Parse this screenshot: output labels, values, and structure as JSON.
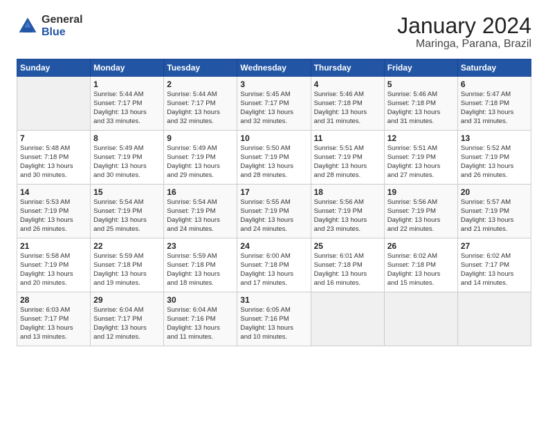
{
  "header": {
    "logo_general": "General",
    "logo_blue": "Blue",
    "month_title": "January 2024",
    "location": "Maringa, Parana, Brazil"
  },
  "days_of_week": [
    "Sunday",
    "Monday",
    "Tuesday",
    "Wednesday",
    "Thursday",
    "Friday",
    "Saturday"
  ],
  "weeks": [
    [
      {
        "day": "",
        "info": ""
      },
      {
        "day": "1",
        "info": "Sunrise: 5:44 AM\nSunset: 7:17 PM\nDaylight: 13 hours\nand 33 minutes."
      },
      {
        "day": "2",
        "info": "Sunrise: 5:44 AM\nSunset: 7:17 PM\nDaylight: 13 hours\nand 32 minutes."
      },
      {
        "day": "3",
        "info": "Sunrise: 5:45 AM\nSunset: 7:17 PM\nDaylight: 13 hours\nand 32 minutes."
      },
      {
        "day": "4",
        "info": "Sunrise: 5:46 AM\nSunset: 7:18 PM\nDaylight: 13 hours\nand 31 minutes."
      },
      {
        "day": "5",
        "info": "Sunrise: 5:46 AM\nSunset: 7:18 PM\nDaylight: 13 hours\nand 31 minutes."
      },
      {
        "day": "6",
        "info": "Sunrise: 5:47 AM\nSunset: 7:18 PM\nDaylight: 13 hours\nand 31 minutes."
      }
    ],
    [
      {
        "day": "7",
        "info": "Sunrise: 5:48 AM\nSunset: 7:18 PM\nDaylight: 13 hours\nand 30 minutes."
      },
      {
        "day": "8",
        "info": "Sunrise: 5:49 AM\nSunset: 7:19 PM\nDaylight: 13 hours\nand 30 minutes."
      },
      {
        "day": "9",
        "info": "Sunrise: 5:49 AM\nSunset: 7:19 PM\nDaylight: 13 hours\nand 29 minutes."
      },
      {
        "day": "10",
        "info": "Sunrise: 5:50 AM\nSunset: 7:19 PM\nDaylight: 13 hours\nand 28 minutes."
      },
      {
        "day": "11",
        "info": "Sunrise: 5:51 AM\nSunset: 7:19 PM\nDaylight: 13 hours\nand 28 minutes."
      },
      {
        "day": "12",
        "info": "Sunrise: 5:51 AM\nSunset: 7:19 PM\nDaylight: 13 hours\nand 27 minutes."
      },
      {
        "day": "13",
        "info": "Sunrise: 5:52 AM\nSunset: 7:19 PM\nDaylight: 13 hours\nand 26 minutes."
      }
    ],
    [
      {
        "day": "14",
        "info": "Sunrise: 5:53 AM\nSunset: 7:19 PM\nDaylight: 13 hours\nand 26 minutes."
      },
      {
        "day": "15",
        "info": "Sunrise: 5:54 AM\nSunset: 7:19 PM\nDaylight: 13 hours\nand 25 minutes."
      },
      {
        "day": "16",
        "info": "Sunrise: 5:54 AM\nSunset: 7:19 PM\nDaylight: 13 hours\nand 24 minutes."
      },
      {
        "day": "17",
        "info": "Sunrise: 5:55 AM\nSunset: 7:19 PM\nDaylight: 13 hours\nand 24 minutes."
      },
      {
        "day": "18",
        "info": "Sunrise: 5:56 AM\nSunset: 7:19 PM\nDaylight: 13 hours\nand 23 minutes."
      },
      {
        "day": "19",
        "info": "Sunrise: 5:56 AM\nSunset: 7:19 PM\nDaylight: 13 hours\nand 22 minutes."
      },
      {
        "day": "20",
        "info": "Sunrise: 5:57 AM\nSunset: 7:19 PM\nDaylight: 13 hours\nand 21 minutes."
      }
    ],
    [
      {
        "day": "21",
        "info": "Sunrise: 5:58 AM\nSunset: 7:19 PM\nDaylight: 13 hours\nand 20 minutes."
      },
      {
        "day": "22",
        "info": "Sunrise: 5:59 AM\nSunset: 7:18 PM\nDaylight: 13 hours\nand 19 minutes."
      },
      {
        "day": "23",
        "info": "Sunrise: 5:59 AM\nSunset: 7:18 PM\nDaylight: 13 hours\nand 18 minutes."
      },
      {
        "day": "24",
        "info": "Sunrise: 6:00 AM\nSunset: 7:18 PM\nDaylight: 13 hours\nand 17 minutes."
      },
      {
        "day": "25",
        "info": "Sunrise: 6:01 AM\nSunset: 7:18 PM\nDaylight: 13 hours\nand 16 minutes."
      },
      {
        "day": "26",
        "info": "Sunrise: 6:02 AM\nSunset: 7:18 PM\nDaylight: 13 hours\nand 15 minutes."
      },
      {
        "day": "27",
        "info": "Sunrise: 6:02 AM\nSunset: 7:17 PM\nDaylight: 13 hours\nand 14 minutes."
      }
    ],
    [
      {
        "day": "28",
        "info": "Sunrise: 6:03 AM\nSunset: 7:17 PM\nDaylight: 13 hours\nand 13 minutes."
      },
      {
        "day": "29",
        "info": "Sunrise: 6:04 AM\nSunset: 7:17 PM\nDaylight: 13 hours\nand 12 minutes."
      },
      {
        "day": "30",
        "info": "Sunrise: 6:04 AM\nSunset: 7:16 PM\nDaylight: 13 hours\nand 11 minutes."
      },
      {
        "day": "31",
        "info": "Sunrise: 6:05 AM\nSunset: 7:16 PM\nDaylight: 13 hours\nand 10 minutes."
      },
      {
        "day": "",
        "info": ""
      },
      {
        "day": "",
        "info": ""
      },
      {
        "day": "",
        "info": ""
      }
    ]
  ]
}
